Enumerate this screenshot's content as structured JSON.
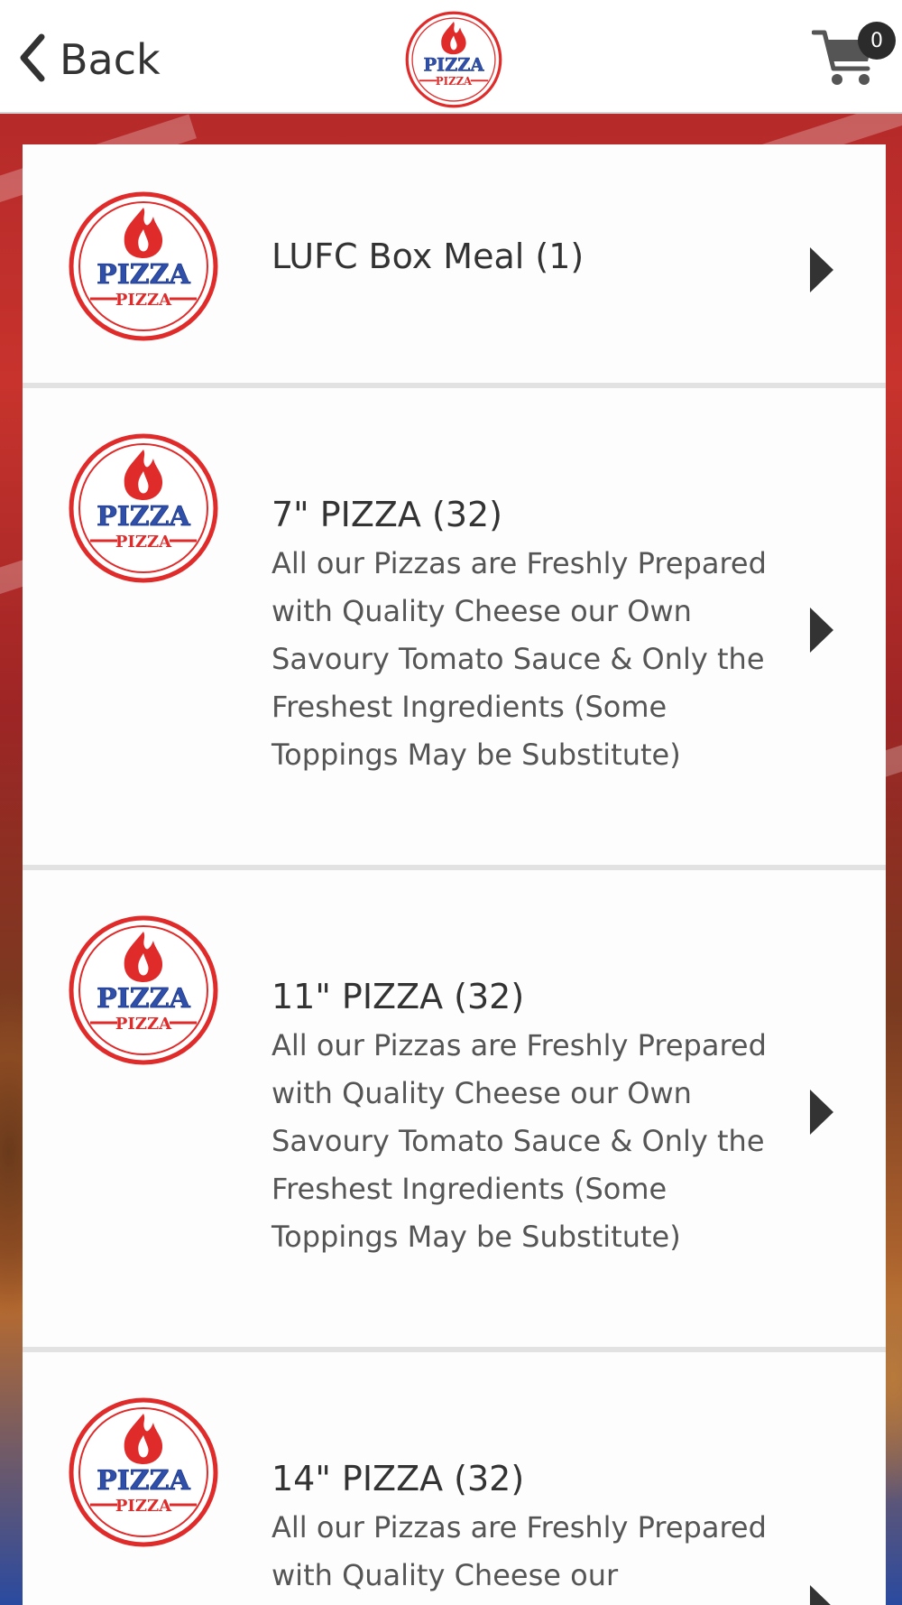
{
  "header": {
    "back_label": "Back",
    "cart_count": "0",
    "logo_icon": "pizza-pizza-logo"
  },
  "menu": {
    "items": [
      {
        "title": "LUFC Box Meal  (1)",
        "description": ""
      },
      {
        "title": "7\" PIZZA  (32)",
        "description": "All our Pizzas are Freshly Prepared with Quality Cheese our Own Savoury Tomato Sauce & Only the Freshest Ingredients (Some Toppings May be Substitute)"
      },
      {
        "title": "11\" PIZZA  (32)",
        "description": "All our Pizzas are Freshly Prepared with Quality Cheese our Own Savoury Tomato Sauce & Only the Freshest Ingredients (Some Toppings May be Substitute)"
      },
      {
        "title": "14\" PIZZA  (32)",
        "description": "All our Pizzas are Freshly Prepared with Quality Cheese our"
      }
    ]
  },
  "colors": {
    "brand_red": "#e02b2b",
    "brand_blue": "#2f4fa8",
    "header_bg": "#ffffff",
    "item_bg": "#fdfdfd",
    "divider": "#e2e2e2"
  }
}
